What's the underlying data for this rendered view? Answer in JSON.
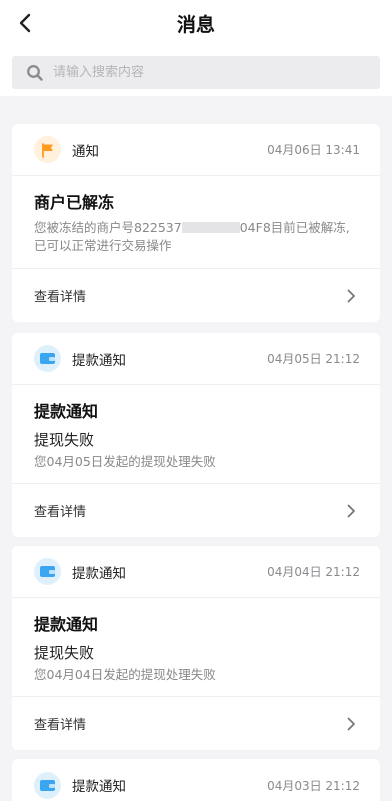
{
  "header": {
    "title": "消息"
  },
  "search": {
    "placeholder": "请输入搜索内容"
  },
  "messages": [
    {
      "type_label": "通知",
      "time": "04月06日 13:41",
      "title": "商户已解冻",
      "desc_prefix": "您被冻结的商户号822537",
      "desc_suffix": "04F8目前已被解冻,已可以正常进行交易操作",
      "detail_label": "查看详情"
    },
    {
      "type_label": "提款通知",
      "time": "04月05日 21:12",
      "title": "提款通知",
      "subtitle": "提现失败",
      "desc": "您04月05日发起的提现处理失败",
      "detail_label": "查看详情"
    },
    {
      "type_label": "提款通知",
      "time": "04月04日 21:12",
      "title": "提款通知",
      "subtitle": "提现失败",
      "desc": "您04月04日发起的提现处理失败",
      "detail_label": "查看详情"
    },
    {
      "type_label": "提款通知",
      "time": "04月03日 21:12"
    }
  ],
  "colors": {
    "notice_icon_bg": "#fff1dc",
    "notice_icon": "#ff9a1f",
    "wallet_icon_bg": "#dff0fd",
    "wallet_icon": "#3aa6f2"
  }
}
